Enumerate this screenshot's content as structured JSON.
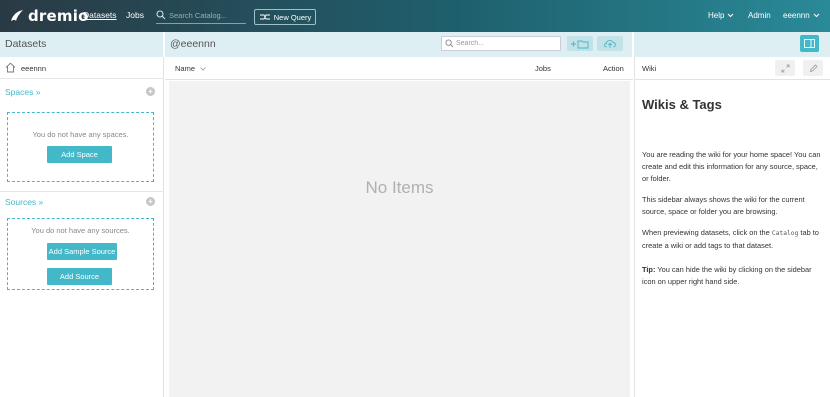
{
  "topbar": {
    "brand": "dremio",
    "nav": {
      "datasets": "Datasets",
      "jobs": "Jobs"
    },
    "search_placeholder": "Search Catalog...",
    "new_query": "New Query",
    "help": "Help",
    "admin": "Admin",
    "user": "eeennn"
  },
  "subheader": {
    "left_title": "Datasets",
    "mid_title": "@eeennn",
    "search_placeholder": "Search..."
  },
  "sidebar": {
    "home": "eeennn",
    "spaces": {
      "title": "Spaces »",
      "empty": "You do not have any spaces.",
      "add_button": "Add Space"
    },
    "sources": {
      "title": "Sources »",
      "empty": "You do not have any sources.",
      "add_sample_button": "Add Sample Source",
      "add_button": "Add Source"
    }
  },
  "table": {
    "columns": {
      "name": "Name",
      "jobs": "Jobs",
      "action": "Action"
    },
    "empty": "No Items"
  },
  "wiki": {
    "label": "Wiki",
    "title": "Wikis & Tags",
    "p1": "You are reading the wiki for your home space! You can create and edit this information for any source, space, or folder.",
    "p2": "This sidebar always shows the wiki for the current source, space or folder you are browsing.",
    "p3_before": "When previewing datasets, click on the ",
    "p3_code": "Catalog",
    "p3_after": " tab to create a wiki or add tags to that dataset.",
    "tip_label": "Tip:",
    "tip_text": " You can hide the wiki by clicking on the sidebar icon on upper right hand side."
  },
  "colors": {
    "accent": "#43b8c9",
    "subheader_bg": "#ddeff3",
    "topbar_dark": "#2a3a44"
  }
}
